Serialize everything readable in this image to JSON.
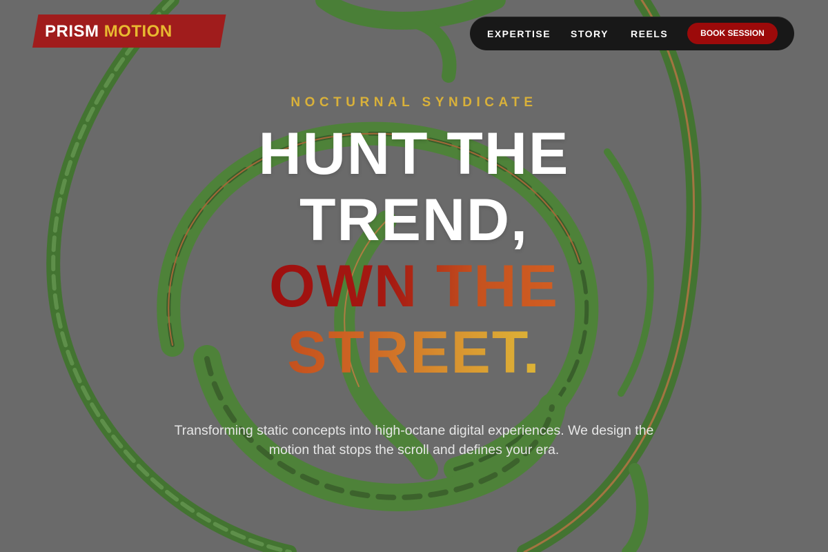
{
  "brand": {
    "name_part1": "PRISM",
    "name_part2": "MOTION"
  },
  "nav": {
    "items": [
      "EXPERTISE",
      "STORY",
      "REELS"
    ],
    "cta": "BOOK SESSION"
  },
  "hero": {
    "eyebrow": "NOCTURNAL SYNDICATE",
    "headline_lines": [
      "HUNT THE",
      "TREND,",
      "OWN THE",
      "STREET."
    ],
    "description": "Transforming static concepts into high-octane digital experiences. We design the motion that stops the scroll and defines your era."
  },
  "colors": {
    "background_overlay": "#6a6a6a",
    "brand_red": "#a01c1c",
    "brand_gold": "#e8b930",
    "nav_bg": "#181818",
    "cta_red": "#9c0a0a",
    "swirl_green": "#3f8f1f"
  }
}
